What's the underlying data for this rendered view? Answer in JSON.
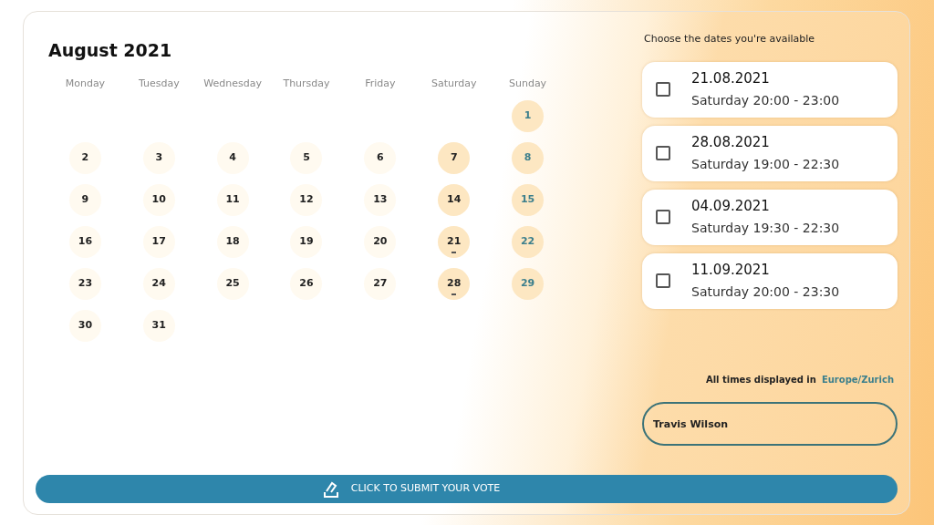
{
  "calendar": {
    "title": "August 2021",
    "weekdays": [
      "Monday",
      "Tuesday",
      "Wednesday",
      "Thursday",
      "Friday",
      "Saturday",
      "Sunday"
    ],
    "days": [
      {
        "day": "1",
        "kind": "sun",
        "has_event": false
      },
      {
        "day": "2",
        "kind": "mon",
        "has_event": false
      },
      {
        "day": "3",
        "kind": "tue",
        "has_event": false
      },
      {
        "day": "4",
        "kind": "wed",
        "has_event": false
      },
      {
        "day": "5",
        "kind": "thu",
        "has_event": false
      },
      {
        "day": "6",
        "kind": "fri",
        "has_event": false
      },
      {
        "day": "7",
        "kind": "sat",
        "has_event": false
      },
      {
        "day": "8",
        "kind": "sun",
        "has_event": false
      },
      {
        "day": "9",
        "kind": "mon",
        "has_event": false
      },
      {
        "day": "10",
        "kind": "tue",
        "has_event": false
      },
      {
        "day": "11",
        "kind": "wed",
        "has_event": false
      },
      {
        "day": "12",
        "kind": "thu",
        "has_event": false
      },
      {
        "day": "13",
        "kind": "fri",
        "has_event": false
      },
      {
        "day": "14",
        "kind": "sat",
        "has_event": false
      },
      {
        "day": "15",
        "kind": "sun",
        "has_event": false
      },
      {
        "day": "16",
        "kind": "mon",
        "has_event": false
      },
      {
        "day": "17",
        "kind": "tue",
        "has_event": false
      },
      {
        "day": "18",
        "kind": "wed",
        "has_event": false
      },
      {
        "day": "19",
        "kind": "thu",
        "has_event": false
      },
      {
        "day": "20",
        "kind": "fri",
        "has_event": false
      },
      {
        "day": "21",
        "kind": "sat",
        "has_event": true
      },
      {
        "day": "22",
        "kind": "sun",
        "has_event": false
      },
      {
        "day": "23",
        "kind": "mon",
        "has_event": false
      },
      {
        "day": "24",
        "kind": "tue",
        "has_event": false
      },
      {
        "day": "25",
        "kind": "wed",
        "has_event": false
      },
      {
        "day": "26",
        "kind": "thu",
        "has_event": false
      },
      {
        "day": "27",
        "kind": "fri",
        "has_event": false
      },
      {
        "day": "28",
        "kind": "sat",
        "has_event": true
      },
      {
        "day": "29",
        "kind": "sun",
        "has_event": false
      },
      {
        "day": "30",
        "kind": "mon",
        "has_event": false
      },
      {
        "day": "31",
        "kind": "tue",
        "has_event": false
      }
    ]
  },
  "availability": {
    "heading": "Choose the dates you're available",
    "options": [
      {
        "date": "21.08.2021",
        "time": "Saturday 20:00 - 23:00",
        "checked": false
      },
      {
        "date": "28.08.2021",
        "time": "Saturday 19:00 - 22:30",
        "checked": false
      },
      {
        "date": "04.09.2021",
        "time": "Saturday 19:30 - 22:30",
        "checked": false
      },
      {
        "date": "11.09.2021",
        "time": "Saturday 20:00 - 23:30",
        "checked": false
      }
    ],
    "timezone_label": "All times displayed in",
    "timezone": "Europe/Zurich",
    "name_field": {
      "value": "Travis Wilson"
    }
  },
  "submit_button": {
    "label": "CLICK TO SUBMIT YOUR VOTE"
  }
}
